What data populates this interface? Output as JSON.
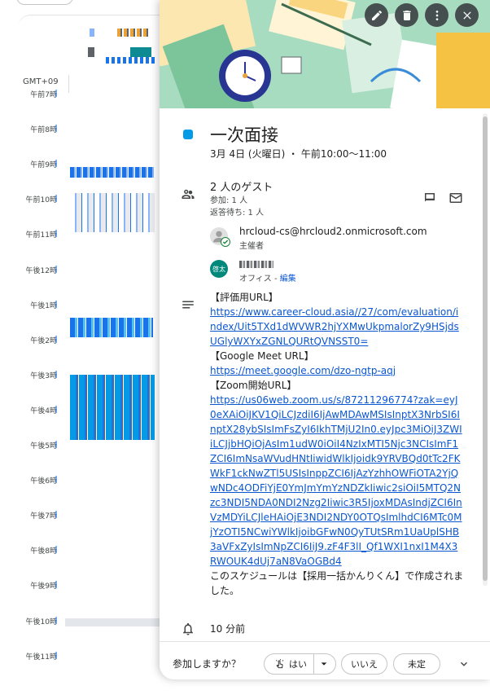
{
  "calendar": {
    "timezone": "GMT+09",
    "hours": [
      "午前7時",
      "午前8時",
      "午前9時",
      "午前10時",
      "午前11時",
      "午後12時",
      "午後1時",
      "午後2時",
      "午後3時",
      "午後4時",
      "午後5時",
      "午後6時",
      "午後7時",
      "午後8時",
      "午後9時",
      "午後10時",
      "午後11時"
    ]
  },
  "event": {
    "color": "#039be5",
    "title": "一次面接",
    "datetime": "3月 4日 (火曜日) ・ 午前10:00～11:00",
    "guests": {
      "summary": "2 人のゲスト",
      "accepted": "参加: 1 人",
      "awaiting": "返答待ち: 1 人",
      "list": [
        {
          "name": "hrcloud-cs@hrcloud2.onmicrosoft.com",
          "role": "主催者"
        },
        {
          "avatar_text": "啓太",
          "role": "オフィス - ",
          "edit_link": "編集"
        }
      ]
    },
    "description": {
      "eval_label": "【評価用URL】",
      "eval_url": "https://www.career-cloud.asia//27/com/evaluation/index/Uit5TXd1dWVWR2hjYXMwUkpmalorZy9HSjdsUGlyWXYxZGNLQURtQVNSST0=",
      "meet_label": "【Google Meet URL】",
      "meet_url": "https://meet.google.com/dzo-ngtp-aqj",
      "zoom_label": "【Zoom開始URL】",
      "zoom_url": "https://us06web.zoom.us/s/87211296774?zak=eyJ0eXAiOiJKV1QiLCJzdiI6IjAwMDAwMSIsInptX3NrbSI6InptX28ybSIsImFsZyI6IkhTMjU2In0.eyJpc3MiOiJ3ZWIiLCJjbHQiOjAsIm1udW0iOiI4NzIxMTI5Njc3NCIsImF1ZCI6ImNsaWVudHNtIiwidWlkIjoidk9YRVBQd0tTc2FKWkF1ckNwZTl5USIsInppZCI6IjAzYzhhOWFiOTA2YjQwNDc4ODFiYjE0YmJmYmYzNDZkIiwic2siOiI5MTQ2Nzc3NDI5NDA0NDI2Nzg2Iiwic3R5IjoxMDAsIndjZCI6InVzMDYiLCJleHAiOjE3NDI2NDY0OTQsImlhdCI6MTc0MjYzOTI5NCwiYWlkIjoibGFwN0QyTUtSRm1UaUplSHB3aVFxZyIsImNpZCI6IiJ9.zF4F3lI_Qf1WXI1nxI1M4X3RWOUK4dUj7aN8VaOGBd4",
      "footer": "このスケジュールは【採用一括かんりくん】で作成されました。"
    },
    "reminder": "10 分前"
  },
  "footer": {
    "question": "参加しますか？",
    "yes": "はい",
    "no": "いいえ",
    "maybe": "未定"
  }
}
